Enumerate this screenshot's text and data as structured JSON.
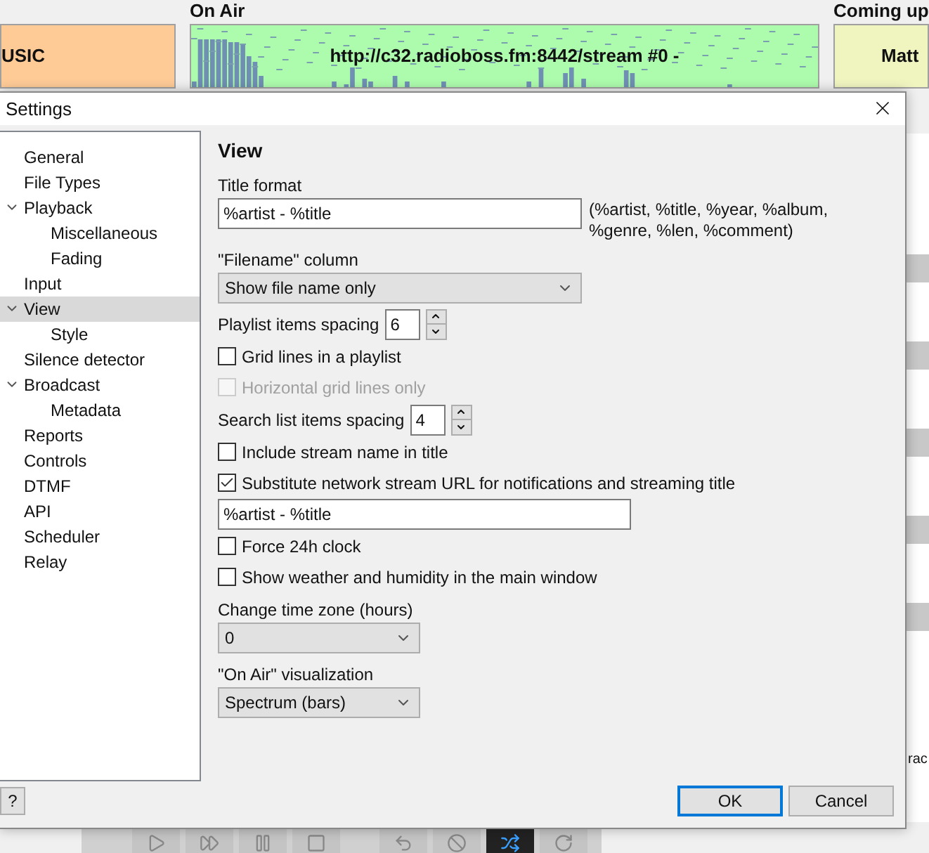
{
  "app": {
    "on_air_label": "On Air",
    "coming_up_label": "Coming up",
    "previous_panel": {
      "text": "USIC"
    },
    "on_air_panel": {
      "text": "http://c32.radioboss.fm:8442/stream #0 -"
    },
    "next_panel": {
      "text": "Matt"
    },
    "side_text": "rac"
  },
  "dialog": {
    "title": "Settings",
    "tree": [
      {
        "label": "General",
        "selected": false
      },
      {
        "label": "File Types",
        "selected": false
      },
      {
        "label": "Playback",
        "selected": false,
        "expanded": true,
        "children": [
          {
            "label": "Miscellaneous",
            "selected": false
          },
          {
            "label": "Fading",
            "selected": false
          }
        ]
      },
      {
        "label": "Input",
        "selected": false
      },
      {
        "label": "View",
        "selected": true,
        "expanded": true,
        "children": [
          {
            "label": "Style",
            "selected": false
          }
        ]
      },
      {
        "label": "Silence detector",
        "selected": false
      },
      {
        "label": "Broadcast",
        "selected": false,
        "expanded": true,
        "children": [
          {
            "label": "Metadata",
            "selected": false
          }
        ]
      },
      {
        "label": "Reports",
        "selected": false
      },
      {
        "label": "Controls",
        "selected": false
      },
      {
        "label": "DTMF",
        "selected": false
      },
      {
        "label": "API",
        "selected": false
      },
      {
        "label": "Scheduler",
        "selected": false
      },
      {
        "label": "Relay",
        "selected": false
      }
    ],
    "heading": "View",
    "controls": [
      {
        "kind": "label",
        "text": "Title format"
      },
      {
        "kind": "field",
        "value": "%artist - %title",
        "hint": "(%artist, %title, %year, %album, %genre, %len, %comment)"
      },
      {
        "kind": "label",
        "text": "\"Filename\" column"
      },
      {
        "kind": "wide_dropdown",
        "value": "Show file name only"
      },
      {
        "kind": "spinner",
        "label": "Playlist items spacing",
        "value": "6"
      },
      {
        "kind": "checkbox",
        "label": "Grid lines in a playlist",
        "checked": false,
        "disabled": false
      },
      {
        "kind": "checkbox",
        "label": "Horizontal grid lines only",
        "checked": false,
        "disabled": true
      },
      {
        "kind": "spinner",
        "label": "Search list items spacing",
        "value": "4"
      },
      {
        "kind": "checkbox",
        "label": "Include stream name in title",
        "checked": false,
        "disabled": false
      },
      {
        "kind": "checkbox",
        "label": "Substitute network stream URL for notifications and streaming title",
        "checked": true,
        "disabled": false
      },
      {
        "kind": "field",
        "value": "%artist - %title"
      },
      {
        "kind": "checkbox",
        "label": "Force 24h clock",
        "checked": false,
        "disabled": false
      },
      {
        "kind": "checkbox",
        "label": "Show weather and humidity in the main window",
        "checked": false,
        "disabled": false
      },
      {
        "kind": "label",
        "text": "Change time zone (hours)"
      },
      {
        "kind": "dropdown",
        "value": "0"
      },
      {
        "kind": "label",
        "text": "\"On Air\" visualization"
      },
      {
        "kind": "dropdown",
        "value": "Spectrum (bars)"
      }
    ],
    "help_button": "?",
    "buttons": [
      {
        "label": "OK",
        "default": true
      },
      {
        "label": "Cancel",
        "default": false
      }
    ]
  }
}
